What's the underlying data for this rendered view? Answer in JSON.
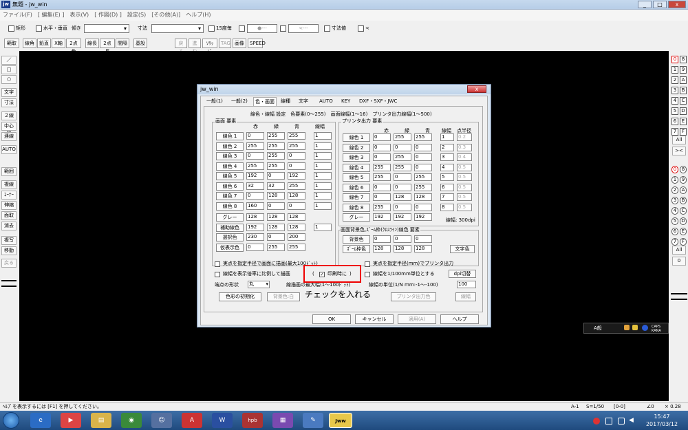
{
  "window": {
    "title": "無題 - jw_win",
    "logo": "jw",
    "minimize": "_",
    "maximize": "□",
    "close": "x"
  },
  "menu": [
    "ファイル(F)",
    "[ 編集(E) ]",
    "表示(V)",
    "[ 作図(D) ]",
    "設定(S)",
    "[その他(A)]",
    "ヘルプ(H)"
  ],
  "toolbar1": {
    "rect": "矩形",
    "hv": "水平・垂直",
    "slope": "傾き",
    "dim": "寸法",
    "deg15": "15度毎",
    "dots": "●---",
    "arrow": "<---",
    "dimval": "寸法値",
    "lt": "<"
  },
  "toolbar2": {
    "b0": "範取",
    "b1": "線角",
    "b2": "鉛直",
    "b3": "X軸",
    "b4": "2点角",
    "b5": "線長",
    "b6": "2点長",
    "b7": "間隔",
    "b8": "基設",
    "b9": "戻る",
    "b10": "進む",
    "b11": "ｿﾘｯﾄﾞ",
    "b12": "TAG",
    "b13": "画像",
    "b14": "SPEED"
  },
  "left_tools": [
    "／",
    "□",
    "○",
    "文字",
    "寸法",
    "２線",
    "中心線",
    "連線",
    "AUTO",
    "範囲",
    "複線",
    "ｺｰﾅｰ",
    "伸縮",
    "面取",
    "消去",
    "複写",
    "移動",
    "戻る"
  ],
  "right_layers_a": [
    [
      "0",
      "8"
    ],
    [
      "1",
      "9"
    ],
    [
      "2",
      "A"
    ],
    [
      "3",
      "B"
    ],
    [
      "4",
      "C"
    ],
    [
      "5",
      "D"
    ],
    [
      "6",
      "E"
    ],
    [
      "7",
      "F"
    ]
  ],
  "right_layers_b": [
    [
      "0",
      "8"
    ],
    [
      "1",
      "9"
    ],
    [
      "2",
      "A"
    ],
    [
      "3",
      "B"
    ],
    [
      "4",
      "C"
    ],
    [
      "5",
      "D"
    ],
    [
      "6",
      "E"
    ],
    [
      "7",
      "F"
    ]
  ],
  "right_all": "All",
  "right_x": "><",
  "right_zero": "0",
  "dialog": {
    "title": "jw_win",
    "close": "x",
    "tabs": [
      "一般(1)",
      "一般(2)",
      "色・画面",
      "線種",
      "文字",
      "AUTO",
      "KEY",
      "DXF・SXF・JWC"
    ],
    "info": "線色・線幅 設定　色要素(0〜255)　画面線幅(1〜16)　プリンタ出力線幅(1〜500)",
    "screen_group": "画面 要素",
    "printer_group": "プリンタ出力 要素",
    "hdr_r": "赤",
    "hdr_g": "緑",
    "hdr_b": "青",
    "hdr_w": "線幅",
    "hdr_pt": "点半径",
    "screen_rows": [
      {
        "label": "線色 1",
        "r": "0",
        "g": "255",
        "b": "255",
        "w": "1"
      },
      {
        "label": "線色 2",
        "r": "255",
        "g": "255",
        "b": "255",
        "w": "1"
      },
      {
        "label": "線色 3",
        "r": "0",
        "g": "255",
        "b": "0",
        "w": "1"
      },
      {
        "label": "線色 4",
        "r": "255",
        "g": "255",
        "b": "0",
        "w": "1"
      },
      {
        "label": "線色 5",
        "r": "192",
        "g": "0",
        "b": "192",
        "w": "1"
      },
      {
        "label": "線色 6",
        "r": "32",
        "g": "32",
        "b": "255",
        "w": "1"
      },
      {
        "label": "線色 7",
        "r": "0",
        "g": "128",
        "b": "128",
        "w": "1"
      },
      {
        "label": "線色 8",
        "r": "160",
        "g": "0",
        "b": "0",
        "w": "1"
      },
      {
        "label": "グレー",
        "r": "128",
        "g": "128",
        "b": "128",
        "w": ""
      },
      {
        "label": "補助線色",
        "r": "192",
        "g": "128",
        "b": "128",
        "w": "1"
      },
      {
        "label": "選択色",
        "r": "230",
        "g": "0",
        "b": "200",
        "w": ""
      },
      {
        "label": "仮表示色",
        "r": "0",
        "g": "255",
        "b": "255",
        "w": ""
      }
    ],
    "printer_rows": [
      {
        "label": "線色 1",
        "r": "0",
        "g": "255",
        "b": "255",
        "w": "1",
        "p": "0.2"
      },
      {
        "label": "線色 2",
        "r": "0",
        "g": "0",
        "b": "0",
        "w": "2",
        "p": "0.3"
      },
      {
        "label": "線色 3",
        "r": "0",
        "g": "255",
        "b": "0",
        "w": "3",
        "p": "0.4"
      },
      {
        "label": "線色 4",
        "r": "255",
        "g": "255",
        "b": "0",
        "w": "4",
        "p": "0.5"
      },
      {
        "label": "線色 5",
        "r": "255",
        "g": "0",
        "b": "255",
        "w": "5",
        "p": "0.5"
      },
      {
        "label": "線色 6",
        "r": "0",
        "g": "0",
        "b": "255",
        "w": "6",
        "p": "0.5"
      },
      {
        "label": "線色 7",
        "r": "0",
        "g": "128",
        "b": "128",
        "w": "7",
        "p": "0.5"
      },
      {
        "label": "線色 8",
        "r": "255",
        "g": "0",
        "b": "0",
        "w": "8",
        "p": "0.5"
      },
      {
        "label": "グレー",
        "r": "192",
        "g": "192",
        "b": "192",
        "w": "",
        "p": ""
      }
    ],
    "line_width_note": "線幅: 300dpi",
    "bg_group": "画面背景色,ｽﾞｰﾑ枠(ｸﾛｽﾗｲﾝ)線色 要素",
    "bg_rows": [
      {
        "label": "背景色",
        "r": "0",
        "g": "0",
        "b": "0"
      },
      {
        "label": "ｽﾞｰﾑ枠色",
        "r": "128",
        "g": "128",
        "b": "128"
      }
    ],
    "text_color_btn": "文字色",
    "chk1": "実点を指定半径で画面に描画(最大100ﾄﾞｯﾄ)",
    "chk2": "線幅を表示倍率に比例して描画",
    "chk3": "印刷時に",
    "chk4": "実点を指定半径(mm)でプリンタ出力",
    "chk5": "線幅を1/100mm単位とする",
    "dpi_btn": "dpi切替",
    "endpoint_label": "端点の形状",
    "endpoint_value": "丸",
    "maxwidth_label": "線描画の最大幅(1〜100ﾄﾞｯﾄ)",
    "unit_label": "線幅の単位(1/N mm:-1〜-100)",
    "unit_value": "100",
    "init_btn": "色彩の初期化",
    "bgcolor_btn": "背景色:白",
    "printcolor_btn": "プリンタ出力色",
    "linewidth_btn": "線幅",
    "annotation": "チェックを入れる",
    "ok": "OK",
    "cancel": "キャンセル",
    "apply": "適用(A)",
    "help": "ヘルプ"
  },
  "status": {
    "hint": "ﾍﾙﾌﾟを表示するには [F1] を押してください。",
    "paper": "A-1",
    "scale": "S=1/50",
    "layer": "[0-0]",
    "angle": "∠0",
    "zoom": "× 0.28"
  },
  "ime": {
    "lang": "A般",
    "caps": "CAPS",
    "kana": "KANA"
  },
  "taskbar": {
    "time": "15:47",
    "date": "2017/03/12",
    "apps": [
      "e",
      "▶",
      "▤",
      "◉",
      "☺",
      "A",
      "W",
      "hpb",
      "▦",
      "✎",
      "Jww"
    ]
  },
  "colors": {
    "canvas": "#000000",
    "highlight": "#e00000"
  }
}
